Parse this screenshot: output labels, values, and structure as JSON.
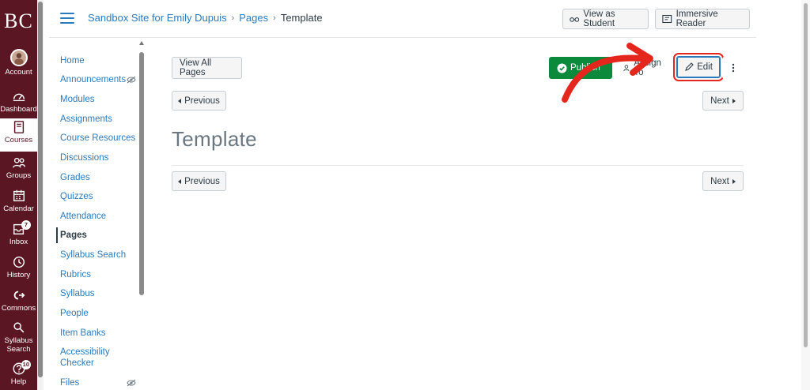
{
  "global_nav": {
    "logo": "BC",
    "accent": "#5a1622",
    "items": [
      {
        "label": "Account",
        "icon": "avatar"
      },
      {
        "label": "Dashboard",
        "icon": "dashboard-icon"
      },
      {
        "label": "Courses",
        "icon": "courses-icon",
        "active": true
      },
      {
        "label": "Groups",
        "icon": "groups-icon"
      },
      {
        "label": "Calendar",
        "icon": "calendar-icon"
      },
      {
        "label": "Inbox",
        "icon": "inbox-icon",
        "badge": "7"
      },
      {
        "label": "History",
        "icon": "history-icon"
      },
      {
        "label": "Commons",
        "icon": "commons-icon"
      },
      {
        "label": "Syllabus Search",
        "icon": "syllabus-search-icon"
      },
      {
        "label": "Help",
        "icon": "help-icon",
        "badge": "10"
      }
    ]
  },
  "header": {
    "breadcrumb": [
      "Sandbox Site for Emily Dupuis",
      "Pages",
      "Template"
    ],
    "view_as_student": "View as Student",
    "immersive_reader": "Immersive Reader"
  },
  "course_nav": {
    "items": [
      {
        "label": "Home"
      },
      {
        "label": "Announcements",
        "hidden": true
      },
      {
        "label": "Modules"
      },
      {
        "label": "Assignments"
      },
      {
        "label": "Course Resources"
      },
      {
        "label": "Discussions"
      },
      {
        "label": "Grades"
      },
      {
        "label": "Quizzes"
      },
      {
        "label": "Attendance"
      },
      {
        "label": "Pages",
        "active": true
      },
      {
        "label": "Syllabus Search"
      },
      {
        "label": "Rubrics"
      },
      {
        "label": "Syllabus"
      },
      {
        "label": "People"
      },
      {
        "label": "Item Banks"
      },
      {
        "label": "Accessibility Checker"
      },
      {
        "label": "Files",
        "hidden": true
      }
    ]
  },
  "toolbar": {
    "view_all_pages": "View All Pages",
    "published": "Publish",
    "assign_to": "Assign To",
    "edit": "Edit",
    "previous": "Previous",
    "next": "Next",
    "publish_color": "#0b8a3c",
    "highlight_color": "#e5261d"
  },
  "page": {
    "title": "Template"
  }
}
